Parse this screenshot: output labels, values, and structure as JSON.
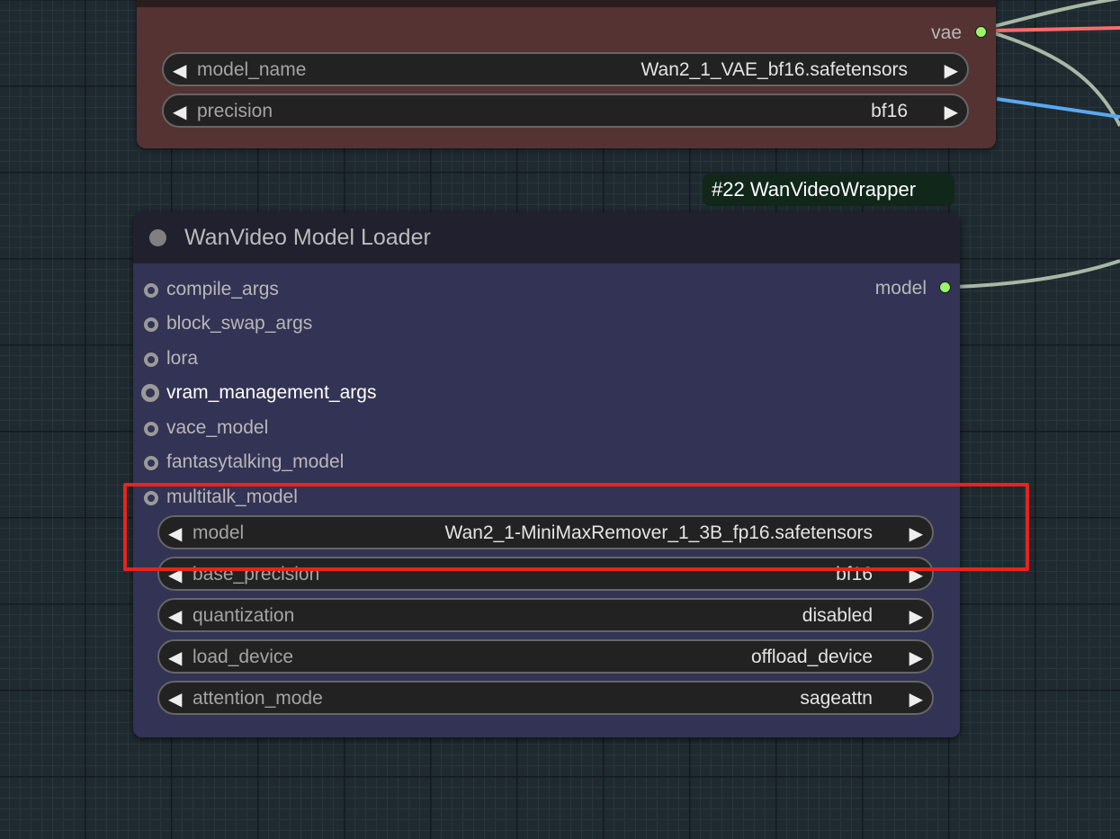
{
  "vae_loader": {
    "output": "vae",
    "widgets": [
      {
        "label": "model_name",
        "value": "Wan2_1_VAE_bf16.safetensors"
      },
      {
        "label": "precision",
        "value": "bf16"
      }
    ]
  },
  "model_loader": {
    "badge": "#22 WanVideoWrapper",
    "title": "WanVideo Model Loader",
    "output": "model",
    "inputs": [
      "compile_args",
      "block_swap_args",
      "lora",
      "vram_management_args",
      "vace_model",
      "fantasytalking_model",
      "multitalk_model"
    ],
    "widgets": [
      {
        "label": "model",
        "value": "Wan2_1-MiniMaxRemover_1_3B_fp16.safetensors"
      },
      {
        "label": "base_precision",
        "value": "bf16"
      },
      {
        "label": "quantization",
        "value": "disabled"
      },
      {
        "label": "load_device",
        "value": "offload_device"
      },
      {
        "label": "attention_mode",
        "value": "sageattn"
      }
    ]
  },
  "glyphs": {
    "left": "◀",
    "right": "▶"
  },
  "colors": {
    "vae_node_bg": "#553333",
    "loader_node_bg": "#333355",
    "output_slot": "#9cf46b",
    "highlight": "#e8231f",
    "link_vae": "#ff6b6b",
    "link_blue": "#5aa8f0",
    "link_model": "#a7b8a5"
  }
}
